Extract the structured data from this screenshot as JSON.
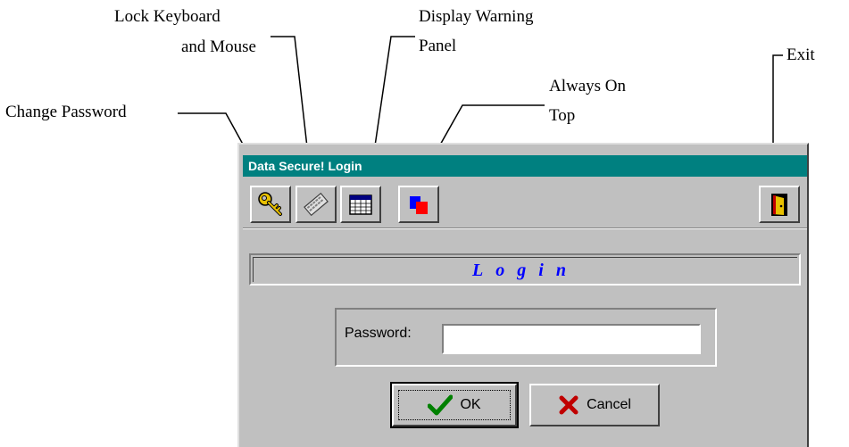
{
  "callouts": {
    "change_password": "Change Password",
    "lock_line1": "Lock Keyboard",
    "lock_line2": "and Mouse",
    "warning_line1": "Display Warning",
    "warning_line2": "Panel",
    "ontop_line1": "Always On",
    "ontop_line2": "Top",
    "exit": "Exit"
  },
  "window": {
    "title": "Data Secure! Login",
    "banner": "Login",
    "password_label": "Password:",
    "password_value": "",
    "ok_label": "OK",
    "cancel_label": "Cancel"
  },
  "toolbar": {
    "icons": [
      "key-icon",
      "keyboard-lock-icon",
      "warning-panel-icon",
      "always-on-top-icon",
      "exit-door-icon"
    ]
  },
  "colors": {
    "titlebar": "#008080",
    "banner_text": "#0000ff",
    "window_face": "#c0c0c0"
  }
}
